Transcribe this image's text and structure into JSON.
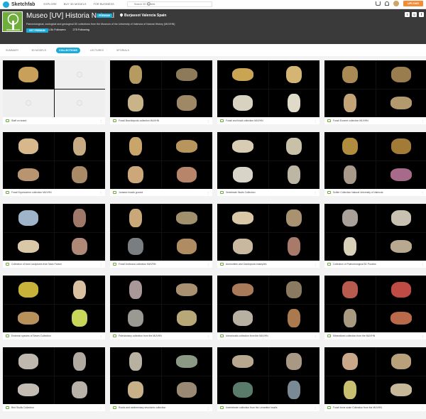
{
  "topbar": {
    "logo_text": "Sketchfab",
    "nav": [
      "EXPLORE",
      "BUY 3D MODELS",
      "FOR BUSINESS"
    ],
    "search_placeholder": "Search 3D models",
    "upload_label": "UPLOAD"
  },
  "header": {
    "title": "Museo [UV] Historia Natural",
    "badge": "PREMIUM",
    "location": "Burjassot Valencia Spain",
    "description": "Paleontological, zoological and geological 3D collections from the Museum of the University of Valencia of Natural History (MUVHN)",
    "follow_label": "GET PREMIUM",
    "followers": "1.5k Followers",
    "following": "275 Following"
  },
  "tabs": [
    {
      "label": "SUMMARY",
      "active": false
    },
    {
      "label": "3D MODELS",
      "active": false
    },
    {
      "label": "COLLECTIONS",
      "active": true
    },
    {
      "label": "LECTURES",
      "active": false
    },
    {
      "label": "SPORIALS",
      "active": false
    }
  ],
  "colors": {
    "accent": "#1caad9",
    "upload": "#f38c36",
    "header_bg": "#3a3a3a"
  },
  "collections": [
    {
      "title": "Staff on board",
      "models": [
        "#c9a05a",
        "",
        "",
        ""
      ]
    },
    {
      "title": "Fossil Brachiopods collection MUVHN",
      "models": [
        "#b59a62",
        "#8c7a58",
        "#c9b48a",
        "#9e8866"
      ]
    },
    {
      "title": "Fossil and fossil collection MUVHN",
      "models": [
        "#c9a553",
        "#d5b574",
        "#d8d3c0",
        "#e0dbc8"
      ]
    },
    {
      "title": "Fossil Eocene collection MUVHN",
      "models": [
        "#a98a55",
        "#9a7d4f",
        "#c2a478",
        "#b39a6e"
      ]
    },
    {
      "title": "Fossil Equinoderm collection MUVHN",
      "models": [
        "#d6b88c",
        "#c7ab82",
        "#b89470",
        "#a88a66"
      ]
    },
    {
      "title": "Jurassic fossils ground",
      "models": [
        "#c9a56a",
        "#b8955c",
        "#cba77a",
        "#b7866a"
      ]
    },
    {
      "title": "Vertebrate Skulls Collection",
      "models": [
        "#d8cdb4",
        "#c9c0a8",
        "#d9d4c8",
        "#bdb6a4"
      ]
    },
    {
      "title": "Scifier Collection Natural University of Valencia",
      "models": [
        "#b08c3e",
        "#a27b36",
        "#a79a8a",
        "#a86a8a"
      ]
    },
    {
      "title": "Collection of bone sculptures from Mars Feavin",
      "models": [
        "#9fb4c9",
        "#a0786a",
        "#d9c8a8",
        "#b08878"
      ]
    },
    {
      "title": "Fossil Anthozoa collection MUVHN",
      "models": [
        "#c8a878",
        "#a0906e",
        "#7a7e80",
        "#b08c62"
      ]
    },
    {
      "title": "Ammonites and Gastropods examples",
      "models": [
        "#d9c8a8",
        "#a89270",
        "#c8b8a0",
        "#a87a6a"
      ]
    },
    {
      "title": "Collection of Paleontological 3D Puzzles",
      "models": [
        "#a9a09a",
        "#c8c0b0",
        "#d8d0b8",
        "#b8a890"
      ]
    },
    {
      "title": "Endemic species of Seven Collection",
      "models": [
        "#c9b23a",
        "#d9c0a0",
        "#b8905a",
        "#c9d45a"
      ]
    },
    {
      "title": "Paleobotany collection from the MUVHN",
      "models": [
        "#a89898",
        "#a89070",
        "#9a9a92",
        "#b8a878"
      ]
    },
    {
      "title": "Ichnofossils collection from the MUVHN",
      "models": [
        "#a87a5a",
        "#8a7a62",
        "#b8b0a0",
        "#a87a4e"
      ]
    },
    {
      "title": "Mineralized collection from the MUVHN",
      "models": [
        "#b85a4e",
        "#c04a44",
        "#a89a80",
        "#b86a4a"
      ]
    },
    {
      "title": "Bird Skulls Collection",
      "models": [
        "#bfb8ae",
        "#b0aaa0",
        "#c2bcb2",
        "#b8b2a8"
      ]
    },
    {
      "title": "Rocks and sedimentary structures collection",
      "models": [
        "#b8b0a0",
        "#8a9a84",
        "#c8b088",
        "#9a8a74"
      ]
    },
    {
      "title": "Invertebrate collection from the Levantine fossils",
      "models": [
        "#b8a890",
        "#a89884",
        "#5a7a6a",
        "#7a8a94"
      ]
    },
    {
      "title": "Fossil bone scale Collection from the MUVHN",
      "models": [
        "#c8a888",
        "#b8a07a",
        "#c8c070",
        "#c8b89a"
      ]
    }
  ]
}
